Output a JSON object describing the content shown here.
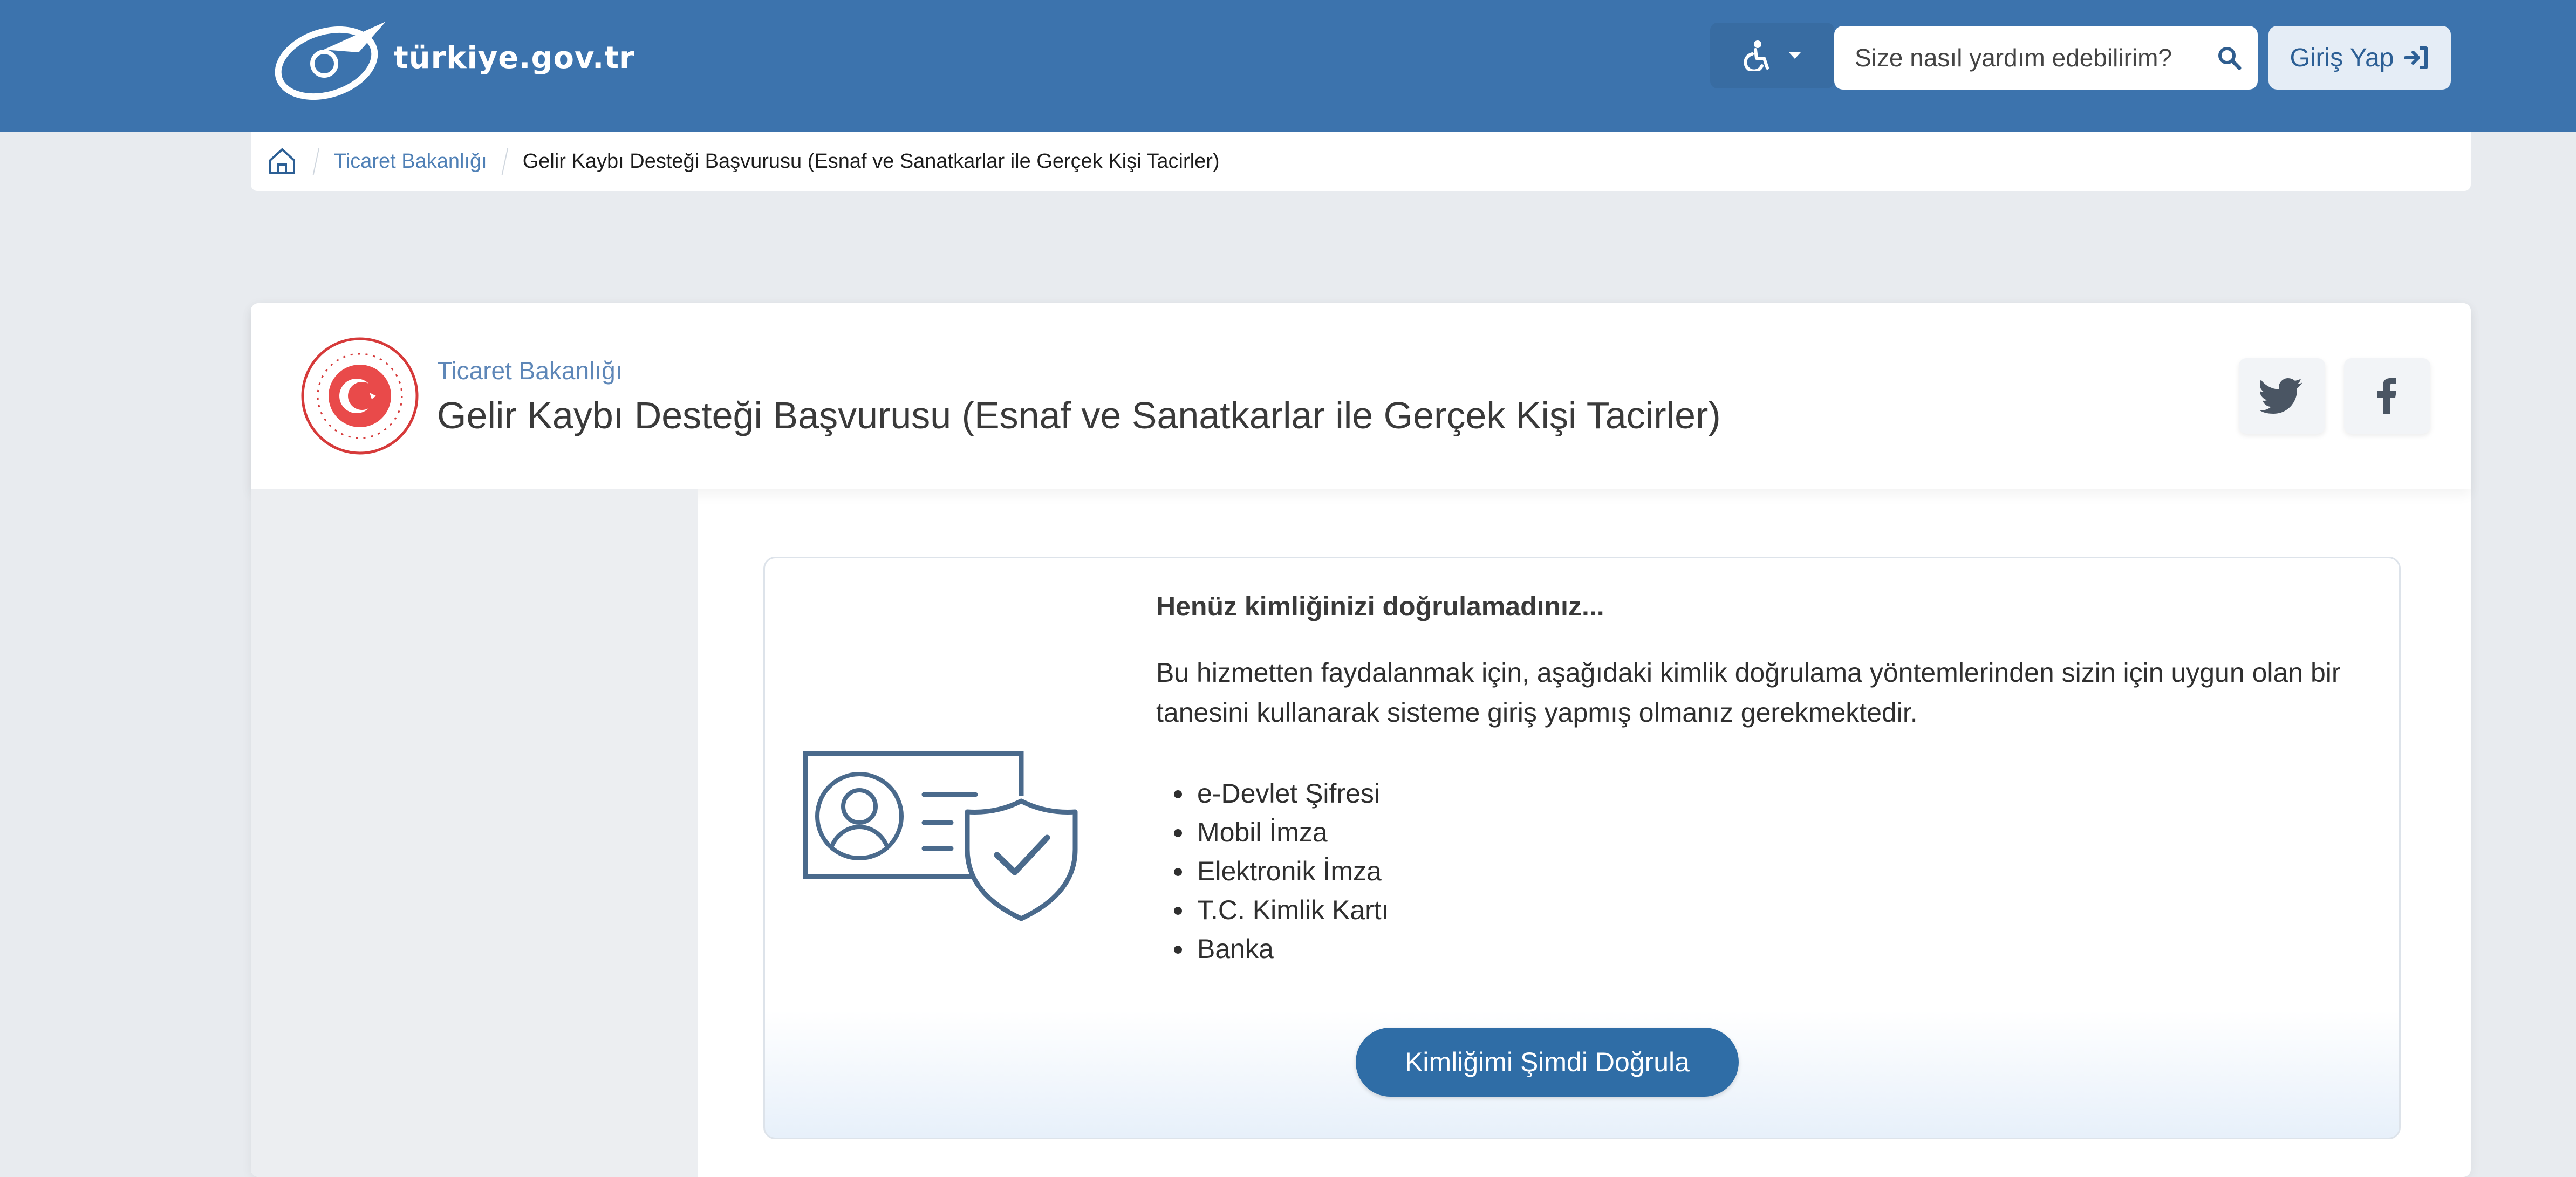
{
  "header": {
    "logo_text": "türkiye.gov.tr",
    "search_placeholder": "Size nasıl yardım edebilirim?",
    "login_label": "Giriş Yap"
  },
  "breadcrumb": {
    "items": [
      "Ticaret Bakanlığı",
      "Gelir Kaybı Desteği Başvurusu (Esnaf ve Sanatkarlar ile Gerçek Kişi Tacirler)"
    ]
  },
  "service": {
    "institution": "Ticaret Bakanlığı",
    "title": "Gelir Kaybı Desteği Başvurusu (Esnaf ve Sanatkarlar ile Gerçek Kişi Tacirler)"
  },
  "notice": {
    "heading": "Henüz kimliğinizi doğrulamadınız...",
    "text": "Bu hizmetten faydalanmak için, aşağıdaki kimlik doğrulama yöntemlerinden sizin için uygun olan bir tanesini kullanarak sisteme giriş yapmış olmanız gerekmektedir.",
    "methods": [
      "e-Devlet Şifresi",
      "Mobil İmza",
      "Elektronik İmza",
      "T.C. Kimlik Kartı",
      "Banka"
    ],
    "button_label": "Kimliğimi Şimdi Doğrula"
  },
  "colors": {
    "header_bg": "#3c73ad",
    "primary_button": "#2f6da6",
    "page_bg": "#e8ebef",
    "link": "#4f80b6"
  },
  "icons": {
    "logo": "turkiye-gov-logo-icon",
    "accessibility": "accessibility-icon",
    "search": "search-icon",
    "login": "sign-in-icon",
    "home": "home-icon",
    "emblem": "ministry-emblem-icon",
    "twitter": "twitter-icon",
    "facebook": "facebook-icon",
    "illustration": "id-card-shield-icon"
  }
}
